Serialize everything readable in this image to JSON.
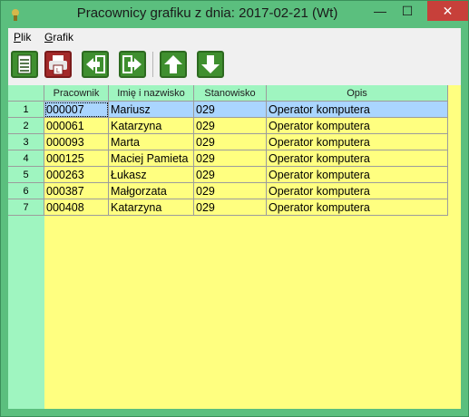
{
  "window": {
    "title": "Pracownicy grafiku z dnia: 2017-02-21 (Wt)",
    "controls": {
      "minimize": "—",
      "maximize": "☐",
      "close": "✕"
    }
  },
  "menu": [
    {
      "label": "Plik",
      "accel": "P"
    },
    {
      "label": "Grafik",
      "accel": "G"
    }
  ],
  "toolbar": [
    {
      "icon": "report-icon",
      "color": "#3f8f2f"
    },
    {
      "icon": "print-icon",
      "color": "#a32929"
    },
    {
      "icon": "arrow-left-icon",
      "color": "#3f8f2f"
    },
    {
      "icon": "arrow-right-icon",
      "color": "#3f8f2f"
    },
    {
      "icon": "arrow-up-icon",
      "color": "#3f8f2f"
    },
    {
      "icon": "arrow-down-icon",
      "color": "#3f8f2f"
    }
  ],
  "table": {
    "columns": [
      "Pracownik",
      "Imię i nazwisko",
      "Stanowisko",
      "Opis"
    ],
    "rows": [
      {
        "num": "1",
        "id": "000007",
        "name": "Mariusz",
        "position": "029",
        "desc": "Operator komputera",
        "selected": true
      },
      {
        "num": "2",
        "id": "000061",
        "name": "Katarzyna",
        "position": "029",
        "desc": "Operator komputera"
      },
      {
        "num": "3",
        "id": "000093",
        "name": "Marta",
        "position": "029",
        "desc": "Operator komputera"
      },
      {
        "num": "4",
        "id": "000125",
        "name": "Maciej Pamieta",
        "position": "029",
        "desc": "Operator komputera"
      },
      {
        "num": "5",
        "id": "000263",
        "name": "Łukasz",
        "position": "029",
        "desc": "Operator komputera"
      },
      {
        "num": "6",
        "id": "000387",
        "name": "Małgorzata",
        "position": "029",
        "desc": "Operator komputera"
      },
      {
        "num": "7",
        "id": "000408",
        "name": "Katarzyna",
        "position": "029",
        "desc": "Operator komputera"
      }
    ]
  },
  "colors": {
    "window": "#5bbf7e",
    "header": "#9ff5c0",
    "grid": "#ffff80",
    "selected": "#aad5ff"
  }
}
